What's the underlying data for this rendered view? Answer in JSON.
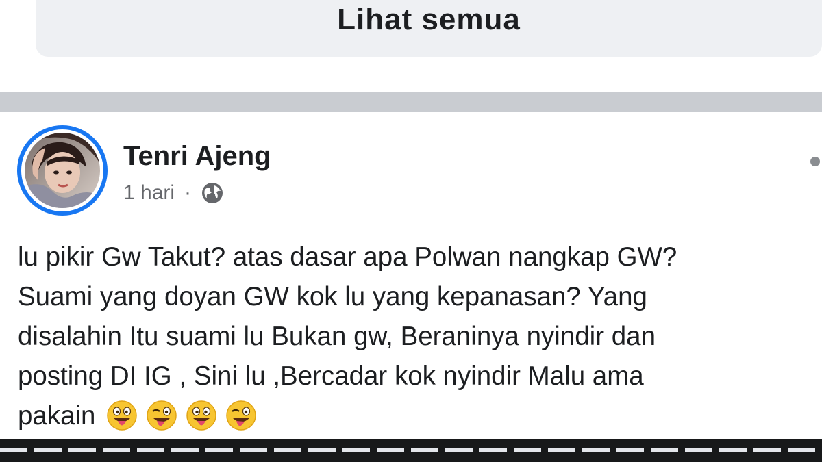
{
  "see_all": {
    "label": "Lihat semua"
  },
  "post": {
    "author": "Tenri Ajeng",
    "time": "1 hari",
    "separator": "·",
    "privacy_icon": "globe-icon",
    "more_icon": "more-options-icon",
    "body_lines": [
      "lu pikir Gw Takut? atas dasar apa Polwan nangkap GW?",
      "Suami yang doyan GW kok lu yang kepanasan? Yang",
      "disalahin Itu suami lu Bukan gw, Beraninya nyindir dan",
      "posting DI IG , Sini lu ,Bercadar kok nyindir Malu ama",
      "pakain"
    ],
    "emojis": [
      "grinning-tongue-emoji",
      "winking-tongue-emoji",
      "grinning-tongue-emoji",
      "winking-tongue-emoji"
    ]
  },
  "colors": {
    "accent": "#1877f2",
    "text": "#1c1e21",
    "muted": "#65676b",
    "button_bg": "#eef0f3",
    "separator": "#c9ccd1",
    "emoji_yellow": "#f7c531",
    "tongue": "#e2476b"
  }
}
